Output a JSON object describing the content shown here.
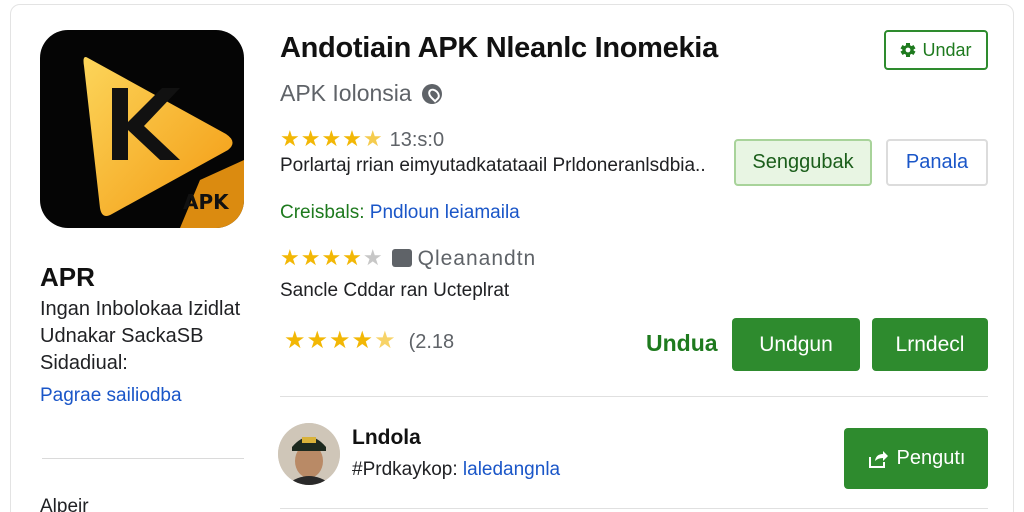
{
  "app": {
    "icon_badge": "APK",
    "title": "APR",
    "description_lines": [
      "Ingan Inbolokaa Izidlat",
      "Udnakar SackaSB",
      "Sidadiual:"
    ],
    "link": "Pagrae sailiodba",
    "bottom_text": "Alpeir"
  },
  "header": {
    "title": "Andotiain APK Nleanlc Inomekia",
    "top_button": "Undar",
    "developer": "APK Iolonsia"
  },
  "rating1": {
    "stars_filled": 4.5,
    "value": "13:s:0"
  },
  "description1": "Porlartaj rrian eimyutadkatataail Prldoneranlsdbia..",
  "buttons": {
    "secondary": "Senggubak",
    "outline": "Panala",
    "undua_label": "Undua",
    "primary1": "Undgun",
    "primary2": "Lrndecl",
    "follow": "Pengutı"
  },
  "category": {
    "label": "Creisbals:",
    "value": "Pndloun leiamaila"
  },
  "review": {
    "stars_filled": 4.5,
    "name": "Qleanandtn",
    "text": "Sancle Cddar ran Ucteplrat"
  },
  "rating2": {
    "stars_filled": 4.5,
    "value": "(2.18"
  },
  "user": {
    "name": "Lndola",
    "handle_label": "#Prdkaykop:",
    "handle_value": "laledangnla"
  },
  "colors": {
    "accent_green": "#2e8b2e",
    "link_blue": "#1a56c8",
    "star_yellow": "#f2b705",
    "icon_yellow": "#f5b820"
  },
  "icons": {
    "app_icon": "play-k-logo-icon",
    "top_button_icon": "gear-icon",
    "developer_icon": "location-pin-icon",
    "review_icon": "chat-bubble-icon",
    "follow_icon": "share-icon"
  }
}
